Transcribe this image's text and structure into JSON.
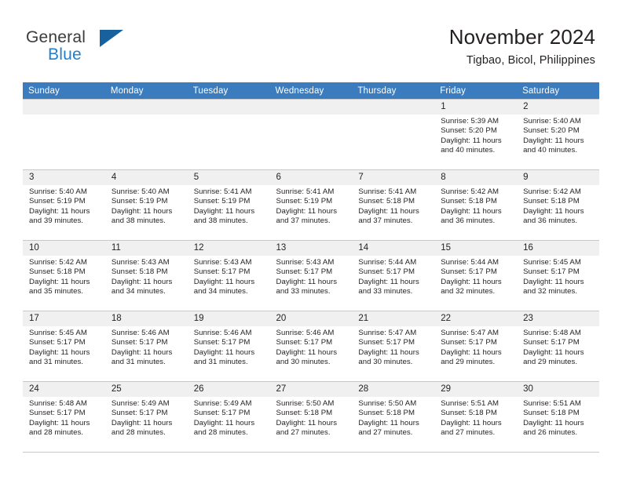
{
  "brand": {
    "name_part1": "General",
    "name_part2": "Blue",
    "logo_icon": "triangle-flag-icon"
  },
  "header": {
    "title": "November 2024",
    "subtitle": "Tigbao, Bicol, Philippines"
  },
  "colors": {
    "header_blue": "#3a7cbe",
    "brand_blue": "#1f7fd0",
    "logo_navy": "#17619f",
    "daynum_band": "#f0f0f0",
    "grid_line": "#c8c8c8"
  },
  "weekdays": [
    "Sunday",
    "Monday",
    "Tuesday",
    "Wednesday",
    "Thursday",
    "Friday",
    "Saturday"
  ],
  "weeks": [
    [
      {
        "day": "",
        "lines": []
      },
      {
        "day": "",
        "lines": []
      },
      {
        "day": "",
        "lines": []
      },
      {
        "day": "",
        "lines": []
      },
      {
        "day": "",
        "lines": []
      },
      {
        "day": "1",
        "lines": [
          "Sunrise: 5:39 AM",
          "Sunset: 5:20 PM",
          "Daylight: 11 hours",
          "and 40 minutes."
        ]
      },
      {
        "day": "2",
        "lines": [
          "Sunrise: 5:40 AM",
          "Sunset: 5:20 PM",
          "Daylight: 11 hours",
          "and 40 minutes."
        ]
      }
    ],
    [
      {
        "day": "3",
        "lines": [
          "Sunrise: 5:40 AM",
          "Sunset: 5:19 PM",
          "Daylight: 11 hours",
          "and 39 minutes."
        ]
      },
      {
        "day": "4",
        "lines": [
          "Sunrise: 5:40 AM",
          "Sunset: 5:19 PM",
          "Daylight: 11 hours",
          "and 38 minutes."
        ]
      },
      {
        "day": "5",
        "lines": [
          "Sunrise: 5:41 AM",
          "Sunset: 5:19 PM",
          "Daylight: 11 hours",
          "and 38 minutes."
        ]
      },
      {
        "day": "6",
        "lines": [
          "Sunrise: 5:41 AM",
          "Sunset: 5:19 PM",
          "Daylight: 11 hours",
          "and 37 minutes."
        ]
      },
      {
        "day": "7",
        "lines": [
          "Sunrise: 5:41 AM",
          "Sunset: 5:18 PM",
          "Daylight: 11 hours",
          "and 37 minutes."
        ]
      },
      {
        "day": "8",
        "lines": [
          "Sunrise: 5:42 AM",
          "Sunset: 5:18 PM",
          "Daylight: 11 hours",
          "and 36 minutes."
        ]
      },
      {
        "day": "9",
        "lines": [
          "Sunrise: 5:42 AM",
          "Sunset: 5:18 PM",
          "Daylight: 11 hours",
          "and 36 minutes."
        ]
      }
    ],
    [
      {
        "day": "10",
        "lines": [
          "Sunrise: 5:42 AM",
          "Sunset: 5:18 PM",
          "Daylight: 11 hours",
          "and 35 minutes."
        ]
      },
      {
        "day": "11",
        "lines": [
          "Sunrise: 5:43 AM",
          "Sunset: 5:18 PM",
          "Daylight: 11 hours",
          "and 34 minutes."
        ]
      },
      {
        "day": "12",
        "lines": [
          "Sunrise: 5:43 AM",
          "Sunset: 5:17 PM",
          "Daylight: 11 hours",
          "and 34 minutes."
        ]
      },
      {
        "day": "13",
        "lines": [
          "Sunrise: 5:43 AM",
          "Sunset: 5:17 PM",
          "Daylight: 11 hours",
          "and 33 minutes."
        ]
      },
      {
        "day": "14",
        "lines": [
          "Sunrise: 5:44 AM",
          "Sunset: 5:17 PM",
          "Daylight: 11 hours",
          "and 33 minutes."
        ]
      },
      {
        "day": "15",
        "lines": [
          "Sunrise: 5:44 AM",
          "Sunset: 5:17 PM",
          "Daylight: 11 hours",
          "and 32 minutes."
        ]
      },
      {
        "day": "16",
        "lines": [
          "Sunrise: 5:45 AM",
          "Sunset: 5:17 PM",
          "Daylight: 11 hours",
          "and 32 minutes."
        ]
      }
    ],
    [
      {
        "day": "17",
        "lines": [
          "Sunrise: 5:45 AM",
          "Sunset: 5:17 PM",
          "Daylight: 11 hours",
          "and 31 minutes."
        ]
      },
      {
        "day": "18",
        "lines": [
          "Sunrise: 5:46 AM",
          "Sunset: 5:17 PM",
          "Daylight: 11 hours",
          "and 31 minutes."
        ]
      },
      {
        "day": "19",
        "lines": [
          "Sunrise: 5:46 AM",
          "Sunset: 5:17 PM",
          "Daylight: 11 hours",
          "and 31 minutes."
        ]
      },
      {
        "day": "20",
        "lines": [
          "Sunrise: 5:46 AM",
          "Sunset: 5:17 PM",
          "Daylight: 11 hours",
          "and 30 minutes."
        ]
      },
      {
        "day": "21",
        "lines": [
          "Sunrise: 5:47 AM",
          "Sunset: 5:17 PM",
          "Daylight: 11 hours",
          "and 30 minutes."
        ]
      },
      {
        "day": "22",
        "lines": [
          "Sunrise: 5:47 AM",
          "Sunset: 5:17 PM",
          "Daylight: 11 hours",
          "and 29 minutes."
        ]
      },
      {
        "day": "23",
        "lines": [
          "Sunrise: 5:48 AM",
          "Sunset: 5:17 PM",
          "Daylight: 11 hours",
          "and 29 minutes."
        ]
      }
    ],
    [
      {
        "day": "24",
        "lines": [
          "Sunrise: 5:48 AM",
          "Sunset: 5:17 PM",
          "Daylight: 11 hours",
          "and 28 minutes."
        ]
      },
      {
        "day": "25",
        "lines": [
          "Sunrise: 5:49 AM",
          "Sunset: 5:17 PM",
          "Daylight: 11 hours",
          "and 28 minutes."
        ]
      },
      {
        "day": "26",
        "lines": [
          "Sunrise: 5:49 AM",
          "Sunset: 5:17 PM",
          "Daylight: 11 hours",
          "and 28 minutes."
        ]
      },
      {
        "day": "27",
        "lines": [
          "Sunrise: 5:50 AM",
          "Sunset: 5:18 PM",
          "Daylight: 11 hours",
          "and 27 minutes."
        ]
      },
      {
        "day": "28",
        "lines": [
          "Sunrise: 5:50 AM",
          "Sunset: 5:18 PM",
          "Daylight: 11 hours",
          "and 27 minutes."
        ]
      },
      {
        "day": "29",
        "lines": [
          "Sunrise: 5:51 AM",
          "Sunset: 5:18 PM",
          "Daylight: 11 hours",
          "and 27 minutes."
        ]
      },
      {
        "day": "30",
        "lines": [
          "Sunrise: 5:51 AM",
          "Sunset: 5:18 PM",
          "Daylight: 11 hours",
          "and 26 minutes."
        ]
      }
    ]
  ]
}
